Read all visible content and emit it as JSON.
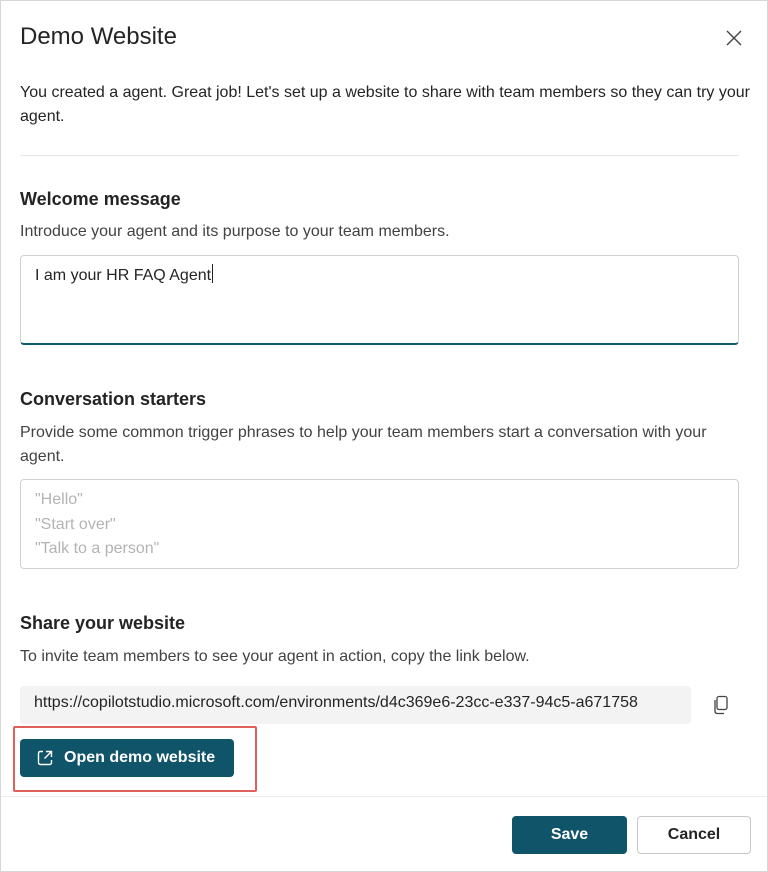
{
  "dialog": {
    "title": "Demo Website",
    "intro": "You created a agent. Great job! Let's set up a website to share with team members so they can try your agent."
  },
  "welcome": {
    "title": "Welcome message",
    "description": "Introduce your agent and its purpose to your team members.",
    "value": "I am your HR FAQ Agent"
  },
  "starters": {
    "title": "Conversation starters",
    "description": "Provide some common trigger phrases to help your team members start a conversation with your agent.",
    "placeholder_lines": [
      "\"Hello\"",
      "\"Start over\"",
      "\"Talk to a person\""
    ]
  },
  "share": {
    "title": "Share your website",
    "description": "To invite team members to see your agent in action, copy the link below.",
    "url": "https://copilotstudio.microsoft.com/environments/d4c369e6-23cc-e337-94c5-a671758",
    "open_button": "Open demo website"
  },
  "footer": {
    "save_label": "Save",
    "cancel_label": "Cancel"
  },
  "colors": {
    "primary": "#0f5468",
    "highlight": "#e0605d"
  },
  "icons": {
    "close": "close-icon",
    "copy": "copy-icon",
    "open": "open-external-icon"
  }
}
